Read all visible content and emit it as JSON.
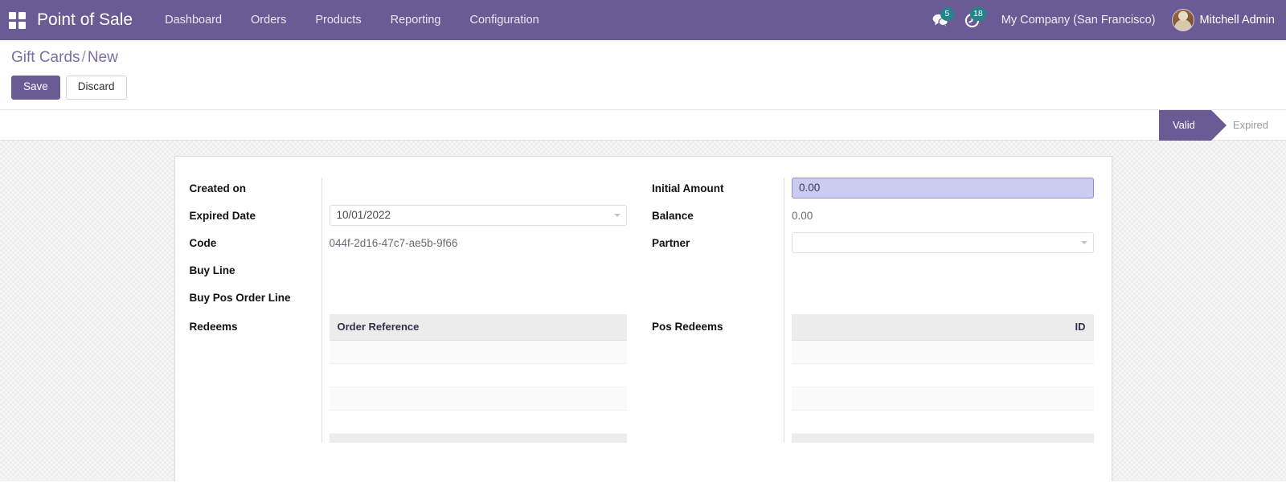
{
  "navbar": {
    "apps_icon": "apps-grid-icon",
    "brand": "Point of Sale",
    "menu_items": [
      {
        "label": "Dashboard"
      },
      {
        "label": "Orders"
      },
      {
        "label": "Products"
      },
      {
        "label": "Reporting"
      },
      {
        "label": "Configuration"
      }
    ],
    "messages": {
      "icon": "messages-icon",
      "count": "5"
    },
    "activities": {
      "icon": "activity-clock-icon",
      "count": "18"
    },
    "company": "My Company (San Francisco)",
    "user": "Mitchell Admin",
    "avatar": "user-avatar"
  },
  "control_panel": {
    "breadcrumb_root": "Gift Cards",
    "breadcrumb_sep": "/",
    "breadcrumb_current": "New",
    "save_label": "Save",
    "discard_label": "Discard"
  },
  "statusbar": {
    "states": [
      {
        "label": "Valid",
        "active": true
      },
      {
        "label": "Expired",
        "active": false
      }
    ],
    "active_label": "Valid",
    "inactive_label": "Expired"
  },
  "form": {
    "left": {
      "created_on": {
        "label": "Created on",
        "value": ""
      },
      "expired_date": {
        "label": "Expired Date",
        "value": "10/01/2022",
        "placeholder": ""
      },
      "code": {
        "label": "Code",
        "value": "044f-2d16-47c7-ae5b-9f66"
      },
      "buy_line": {
        "label": "Buy Line",
        "value": ""
      },
      "buy_pos_order_line": {
        "label": "Buy Pos Order Line",
        "value": ""
      },
      "redeems": {
        "label": "Redeems",
        "columns": [
          "Order Reference"
        ],
        "rows": []
      }
    },
    "right": {
      "initial_amount": {
        "label": "Initial Amount",
        "value": "0.00"
      },
      "balance": {
        "label": "Balance",
        "value": "0.00"
      },
      "partner": {
        "label": "Partner",
        "value": "",
        "placeholder": ""
      },
      "pos_redeems": {
        "label": "Pos Redeems",
        "columns": [
          "ID"
        ],
        "rows": []
      }
    }
  },
  "colors": {
    "brand_purple": "#6b5b95",
    "badge_teal": "#21858a",
    "focus_field_bg": "#ccccf0",
    "table_header_bg": "#ececec",
    "breadcrumb_text": "#7b6ea4"
  }
}
